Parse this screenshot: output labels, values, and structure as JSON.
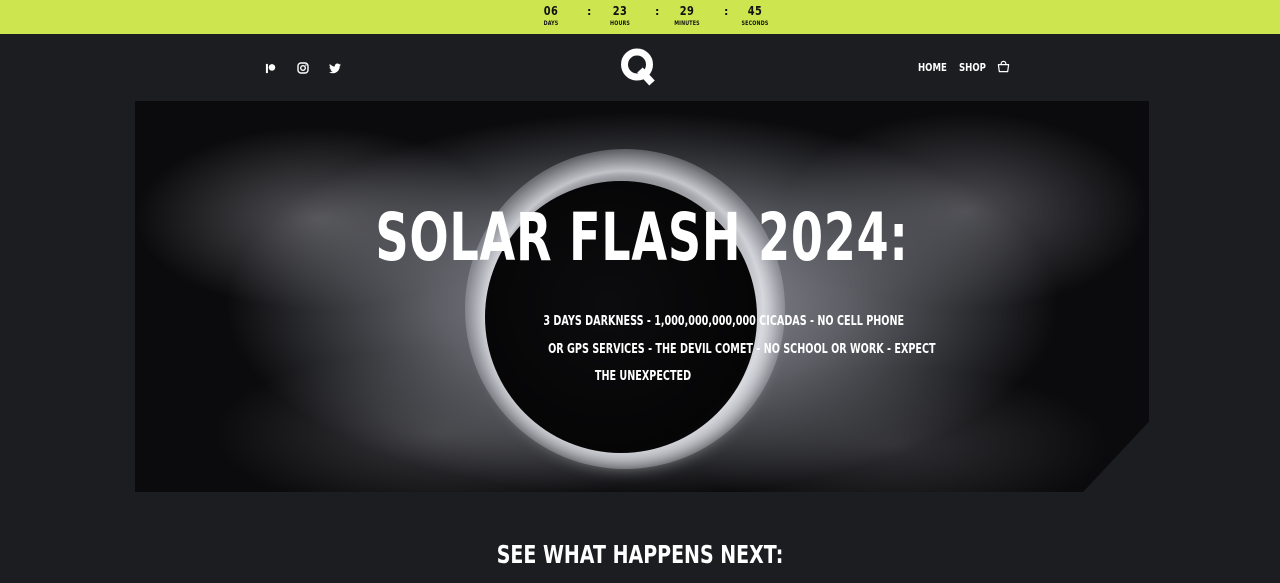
{
  "countdown": {
    "days": {
      "value": "06",
      "label": "DAYS"
    },
    "hours": {
      "value": "23",
      "label": "HOURS"
    },
    "minutes": {
      "value": "29",
      "label": "MINUTES"
    },
    "seconds": {
      "value": "45",
      "label": "SECONDS"
    },
    "separator": ":",
    "bar_color": "#cde650"
  },
  "header": {
    "social_icons": [
      "patreon-icon",
      "instagram-icon",
      "twitter-icon"
    ],
    "logo_text": "Q",
    "nav": {
      "home": "HOME",
      "shop": "SHOP"
    },
    "cart_icon": "shopping-bag-icon"
  },
  "hero": {
    "title": "SOLAR FLASH 2024:",
    "subtitle_lines": [
      "3 DAYS DARKNESS - 1,000,000,000,000 CICADAS - NO CELL PHONE",
      "OR GPS SERVICES - THE DEVIL COMET - NO SCHOOL OR WORK - EXPECT",
      "THE UNEXPECTED"
    ]
  },
  "next_section": {
    "title": "SEE WHAT HAPPENS NEXT:"
  }
}
